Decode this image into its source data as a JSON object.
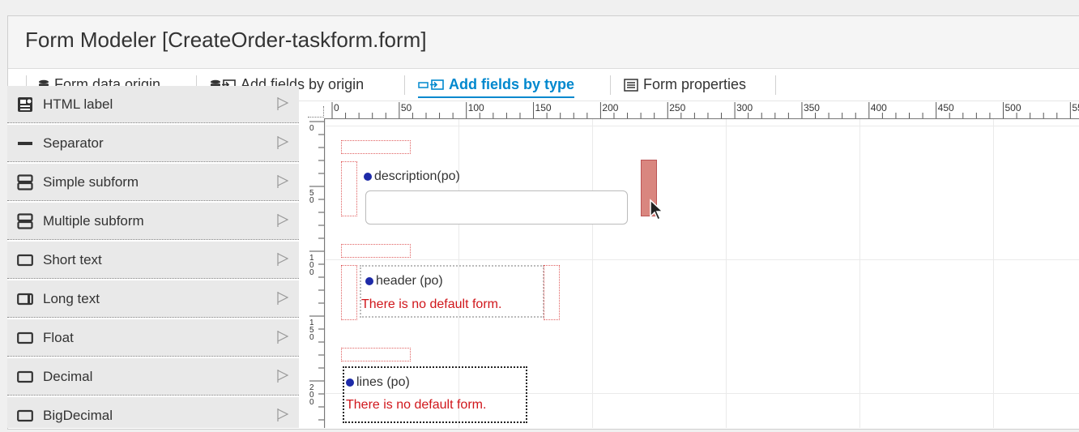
{
  "window": {
    "title": "Form Modeler [CreateOrder-taskform.form]"
  },
  "tabs": [
    {
      "label": "Form data origin",
      "icon": "database-icon",
      "active": false
    },
    {
      "label": "Add fields by origin",
      "icon": "database-add-icon",
      "active": false
    },
    {
      "label": "Add fields by type",
      "icon": "field-add-icon",
      "active": true
    },
    {
      "label": "Form properties",
      "icon": "form-properties-icon",
      "active": false
    }
  ],
  "palette": {
    "items": [
      {
        "label": "HTML label",
        "icon": "html-label-icon"
      },
      {
        "label": "Separator",
        "icon": "separator-icon"
      },
      {
        "label": "Simple subform",
        "icon": "subform-icon"
      },
      {
        "label": "Multiple subform",
        "icon": "subform-icon"
      },
      {
        "label": "Short text",
        "icon": "textbox-icon"
      },
      {
        "label": "Long text",
        "icon": "textarea-icon"
      },
      {
        "label": "Float",
        "icon": "textbox-icon"
      },
      {
        "label": "Decimal",
        "icon": "textbox-icon"
      },
      {
        "label": "BigDecimal",
        "icon": "textbox-icon"
      }
    ],
    "flag_icon": "flag-icon"
  },
  "ruler": {
    "top_labels": [
      "0",
      "50",
      "100",
      "150",
      "200",
      "250",
      "300",
      "350",
      "400",
      "450",
      "500",
      "55"
    ],
    "left_labels": [
      "0",
      "50",
      "100",
      "150",
      "200"
    ]
  },
  "canvas": {
    "fields": [
      {
        "label": "description(po)",
        "error": ""
      },
      {
        "label": "header (po)",
        "error": "There is no default form."
      },
      {
        "label": "lines (po)",
        "error": "There is no default form."
      }
    ]
  },
  "colors": {
    "accent": "#0088ce",
    "error": "#d0161b",
    "field_dot": "#1d2aa8",
    "drop_indicator": "#d9867f"
  }
}
